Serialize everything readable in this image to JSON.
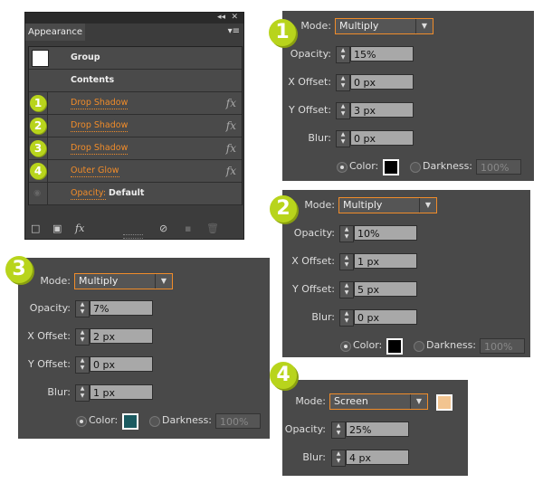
{
  "appearance": {
    "tab": "Appearance",
    "rows": [
      {
        "label": "Group"
      },
      {
        "label": "Contents"
      },
      {
        "label": "Drop Shadow",
        "badge": "1"
      },
      {
        "label": "Drop Shadow",
        "badge": "2"
      },
      {
        "label": "Drop Shadow",
        "badge": "3"
      },
      {
        "label": "Outer Glow",
        "badge": "4"
      }
    ],
    "opacity_label": "Opacity:",
    "opacity_value": "Default",
    "fx": "fx"
  },
  "labels": {
    "mode": "Mode:",
    "opacity": "Opacity:",
    "xoff": "X Offset:",
    "yoff": "Y Offset:",
    "blur": "Blur:",
    "color": "Color:",
    "darkness": "Darkness:"
  },
  "panels": [
    {
      "badge": "1",
      "mode": "Multiply",
      "opacity": "15%",
      "x": "0 px",
      "y": "3 px",
      "blur": "0 px",
      "darkness": "100%",
      "color": "#000000"
    },
    {
      "badge": "2",
      "mode": "Multiply",
      "opacity": "10%",
      "x": "1 px",
      "y": "5 px",
      "blur": "0 px",
      "darkness": "100%",
      "color": "#000000"
    },
    {
      "badge": "3",
      "mode": "Multiply",
      "opacity": "7%",
      "x": "2 px",
      "y": "0 px",
      "blur": "1 px",
      "darkness": "100%",
      "color": "#1a5a60"
    },
    {
      "badge": "4",
      "mode": "Screen",
      "opacity": "25%",
      "blur": "4 px",
      "color": "#f2c490"
    }
  ]
}
